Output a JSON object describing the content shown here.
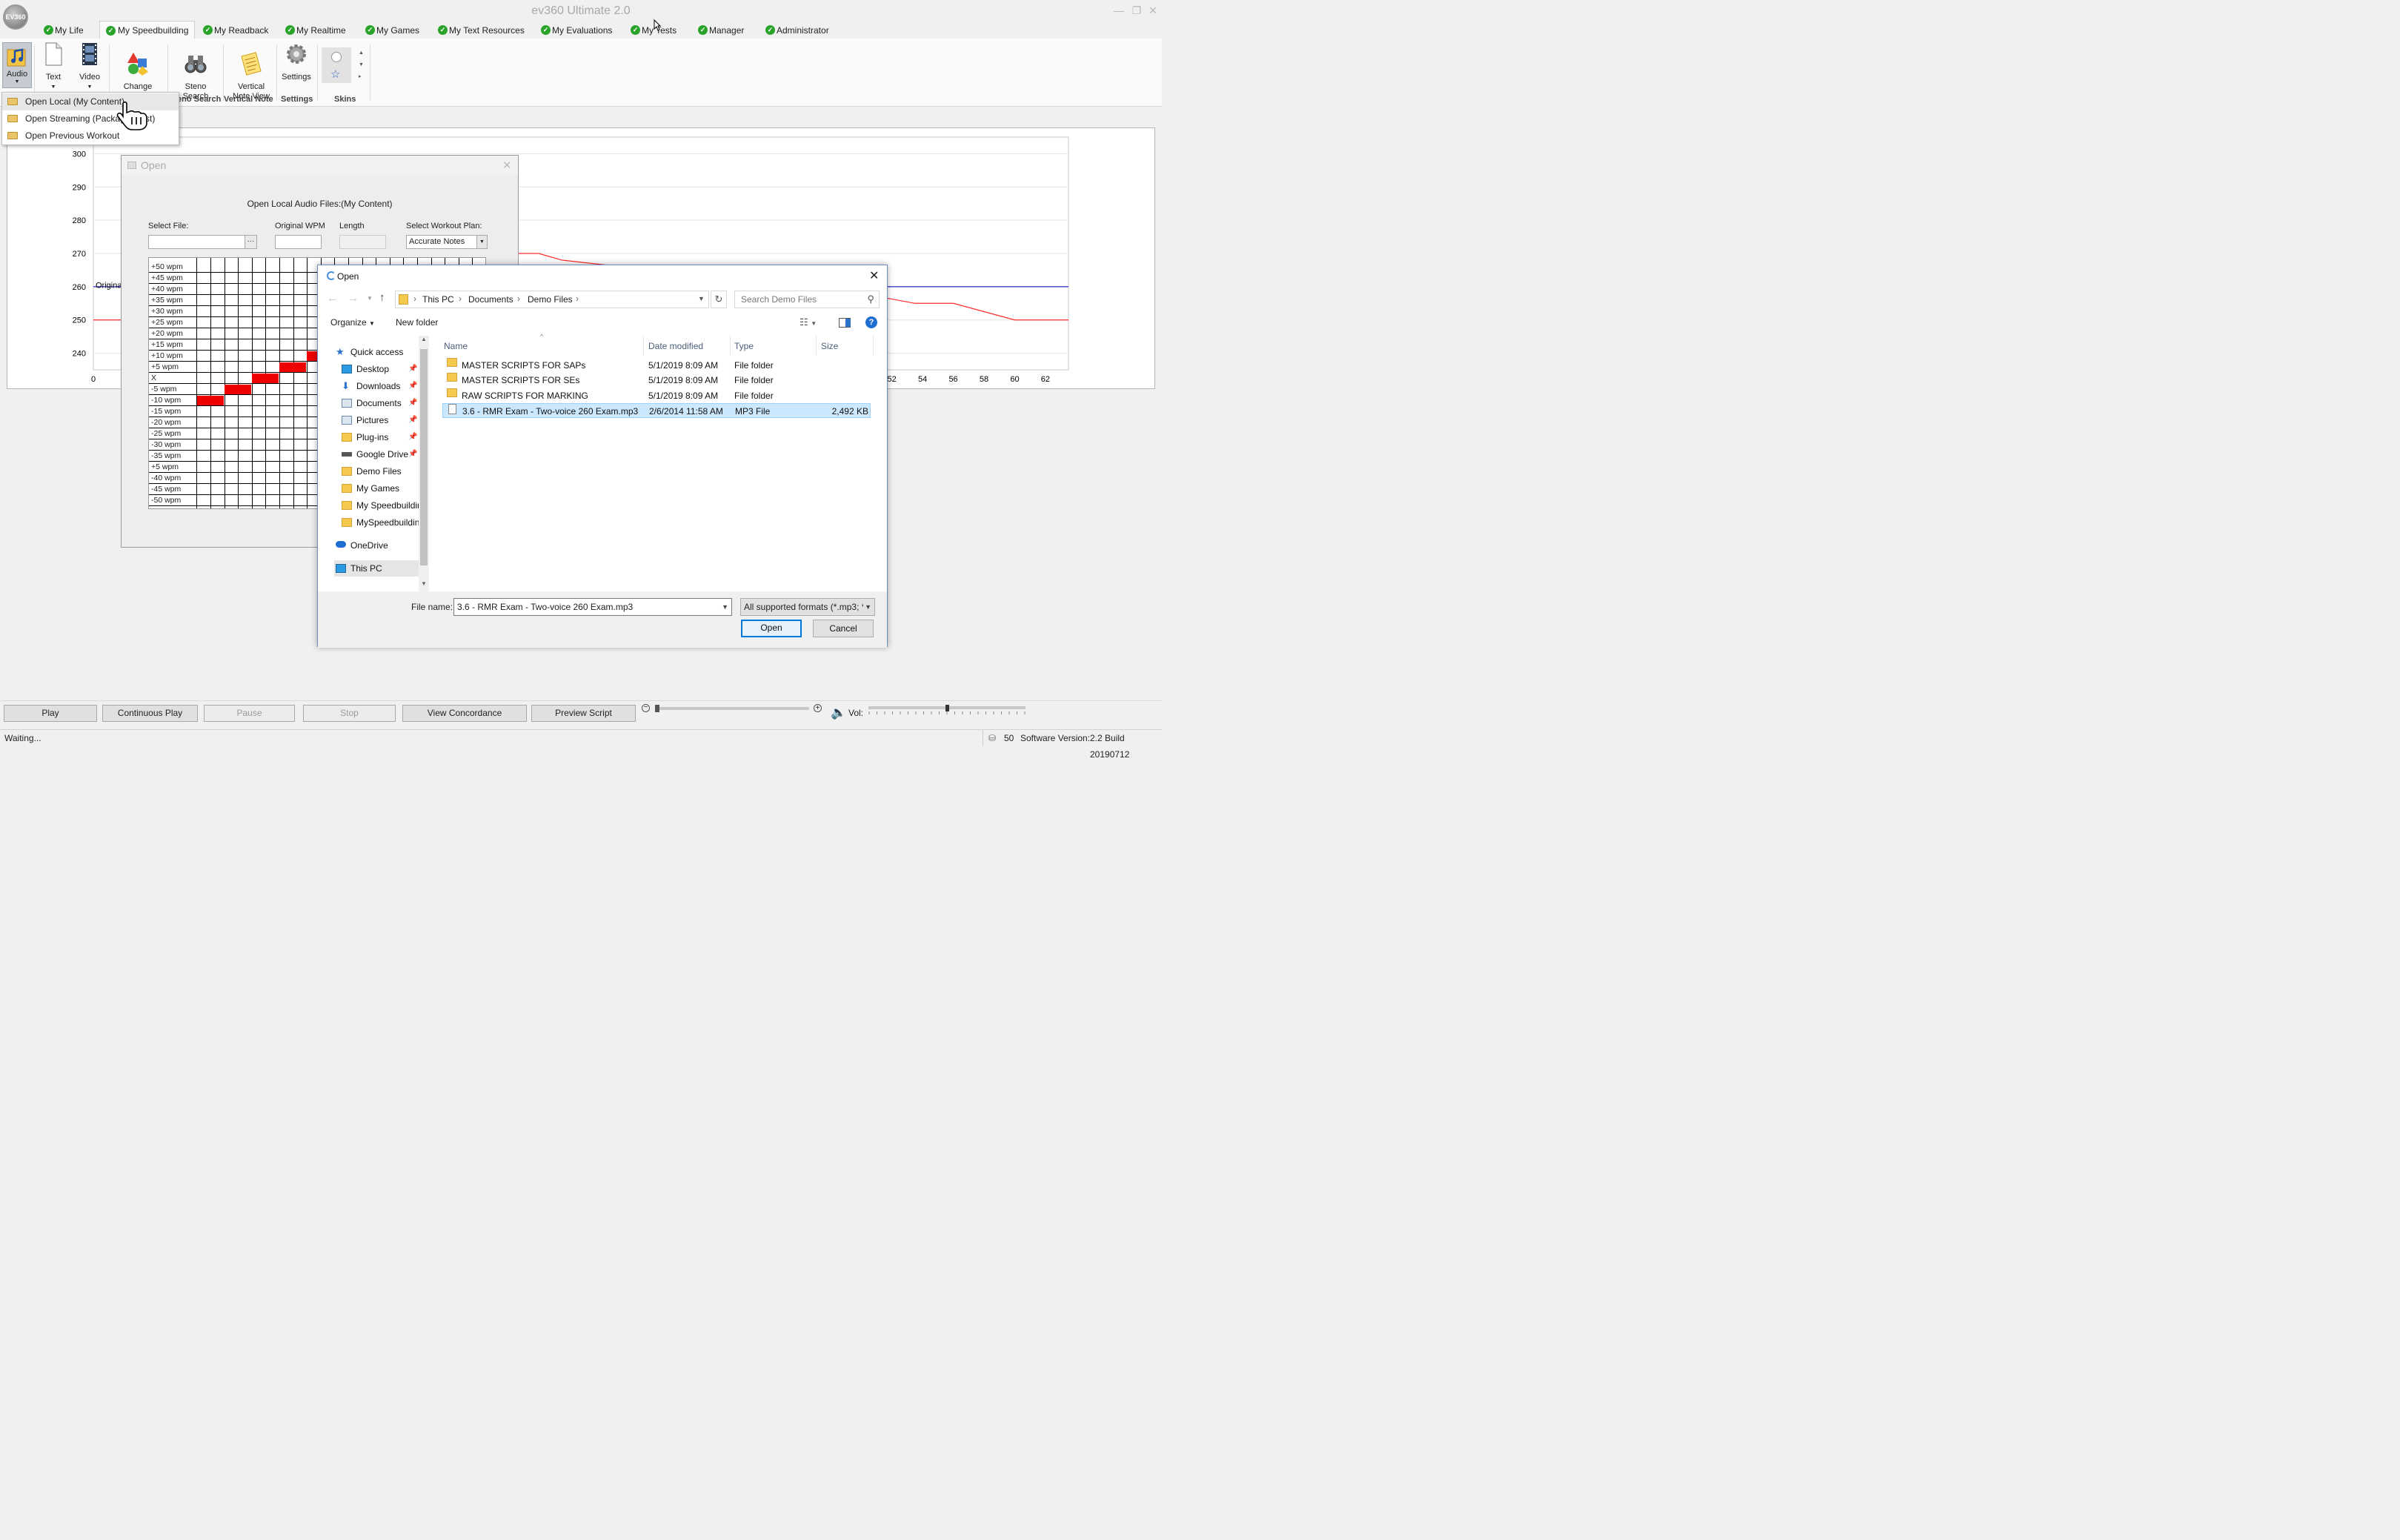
{
  "window": {
    "title": "ev360 Ultimate 2.0",
    "logo_text": "EV360",
    "minimize": "—",
    "restore": "❐",
    "close": "✕"
  },
  "tabs": [
    "My Life",
    "My Speedbuilding",
    "My Readback",
    "My Realtime",
    "My Games",
    "My Text Resources",
    "My Evaluations",
    "My Tests",
    "Manager",
    "Administrator"
  ],
  "ribbon": {
    "buttons": [
      {
        "label": "Audio",
        "icon": "audio-icon"
      },
      {
        "label": "Text",
        "icon": "text-document-icon"
      },
      {
        "label": "Video",
        "icon": "video-film-icon"
      },
      {
        "label": "Change\nWorkout Plan",
        "icon": "shapes-icon"
      },
      {
        "label": "Steno\nSearch",
        "icon": "binoculars-icon"
      },
      {
        "label": "Vertical\nNote View",
        "icon": "notepad-icon"
      },
      {
        "label": "Settings",
        "icon": "gear-icon"
      }
    ],
    "groups": [
      "eno Search",
      "Vertical Note",
      "Settings",
      "Skins"
    ]
  },
  "audio_menu": {
    "items": [
      "Open Local (My Content)",
      "Open Streaming (Package List)",
      "Open Previous Workout"
    ],
    "visible_item_2": "Open Streaming (Packag",
    "visible_item_2_tail": "st)"
  },
  "chart_data": {
    "type": "line",
    "title": "",
    "xlabel": "",
    "ylabel": "",
    "ylim": [
      235,
      305
    ],
    "yticks": [
      240,
      250,
      260,
      270,
      280,
      290,
      300
    ],
    "xticks_visible": [
      0,
      52,
      54,
      56,
      58,
      60,
      62
    ],
    "xlim": [
      0,
      63.5
    ],
    "legend_fragment": "Origina",
    "series": [
      {
        "name": "Original",
        "color": "#2b2bc8",
        "x": [
          0,
          63.5
        ],
        "y": [
          260,
          260
        ]
      },
      {
        "color": "#ff2a2a",
        "x": [
          0,
          2.5,
          20,
          21,
          29,
          30.5,
          50,
          53.5,
          56,
          60,
          63.5
        ],
        "y": [
          250,
          250,
          265,
          270,
          270,
          268,
          258,
          255,
          255,
          250,
          250
        ]
      }
    ]
  },
  "open_panel": {
    "title": "Open",
    "heading": "Open Local Audio Files:(My Content)",
    "select_file_label": "Select File:",
    "original_wpm_label": "Original WPM",
    "length_label": "Length",
    "workout_plan_label": "Select Workout Plan:",
    "workout_plan_value": "Accurate Notes",
    "browse": "···",
    "grid_rows": [
      "+50 wpm",
      "+45 wpm",
      "+40 wpm",
      "+35 wpm",
      "+30 wpm",
      "+25 wpm",
      "+20 wpm",
      "+15 wpm",
      "+10 wpm",
      "+5 wpm",
      "X",
      "-5 wpm",
      "-10 wpm",
      "-15 wpm",
      "-20 wpm",
      "-25 wpm",
      "-30 wpm",
      "-35 wpm",
      "+5 wpm",
      "-40 wpm",
      "-45 wpm",
      "-50 wpm"
    ]
  },
  "file_dialog": {
    "title": "Open",
    "breadcrumb": [
      "This PC",
      "Documents",
      "Demo Files"
    ],
    "search_placeholder": "Search Demo Files",
    "organize": "Organize",
    "new_folder": "New folder",
    "nav_items": [
      {
        "label": "Quick access",
        "icon": "star-icon",
        "pinned": false
      },
      {
        "label": "Desktop",
        "icon": "desktop-icon",
        "pinned": true
      },
      {
        "label": "Downloads",
        "icon": "download-icon",
        "pinned": true
      },
      {
        "label": "Documents",
        "icon": "documents-icon",
        "pinned": true
      },
      {
        "label": "Pictures",
        "icon": "pictures-icon",
        "pinned": true
      },
      {
        "label": "Plug-ins",
        "icon": "folder-icon",
        "pinned": true
      },
      {
        "label": "Google Drive",
        "icon": "drive-icon",
        "pinned": true
      },
      {
        "label": "Demo Files",
        "icon": "folder-icon",
        "pinned": false
      },
      {
        "label": "My Games",
        "icon": "folder-icon",
        "pinned": false
      },
      {
        "label": "My Speedbuildir",
        "icon": "folder-icon",
        "pinned": false
      },
      {
        "label": "MySpeedbuildin",
        "icon": "folder-icon",
        "pinned": false
      },
      {
        "label": "OneDrive",
        "icon": "cloud-icon",
        "pinned": false
      },
      {
        "label": "This PC",
        "icon": "pc-icon",
        "pinned": false
      }
    ],
    "columns": [
      "Name",
      "Date modified",
      "Type",
      "Size"
    ],
    "files": [
      {
        "name": "MASTER SCRIPTS FOR SAPs",
        "date": "5/1/2019 8:09 AM",
        "type": "File folder",
        "size": "",
        "kind": "folder"
      },
      {
        "name": "MASTER SCRIPTS FOR SEs",
        "date": "5/1/2019 8:09 AM",
        "type": "File folder",
        "size": "",
        "kind": "folder"
      },
      {
        "name": "RAW SCRIPTS FOR MARKING",
        "date": "5/1/2019 8:09 AM",
        "type": "File folder",
        "size": "",
        "kind": "folder"
      },
      {
        "name": "3.6 - RMR Exam - Two-voice 260 Exam.mp3",
        "date": "2/6/2014 11:58 AM",
        "type": "MP3 File",
        "size": "2,492 KB",
        "kind": "file"
      }
    ],
    "file_name_label": "File name:",
    "file_name_value": "3.6 - RMR Exam - Two-voice 260 Exam.mp3",
    "filter": "All supported formats (*.mp3; *",
    "open_button": "Open",
    "cancel_button": "Cancel"
  },
  "playback": {
    "buttons": [
      "Play",
      "Continuous Play",
      "Pause",
      "Stop",
      "View Concordance",
      "Preview  Script"
    ],
    "disabled": [
      false,
      false,
      true,
      true,
      false,
      false
    ],
    "volume_label": "Vol:",
    "speed_position": 0.0,
    "volume_level": 0.5
  },
  "status": {
    "text": "Waiting...",
    "count": "50",
    "version_label": "Software Version:",
    "version": "2.2 Build 20190712"
  }
}
